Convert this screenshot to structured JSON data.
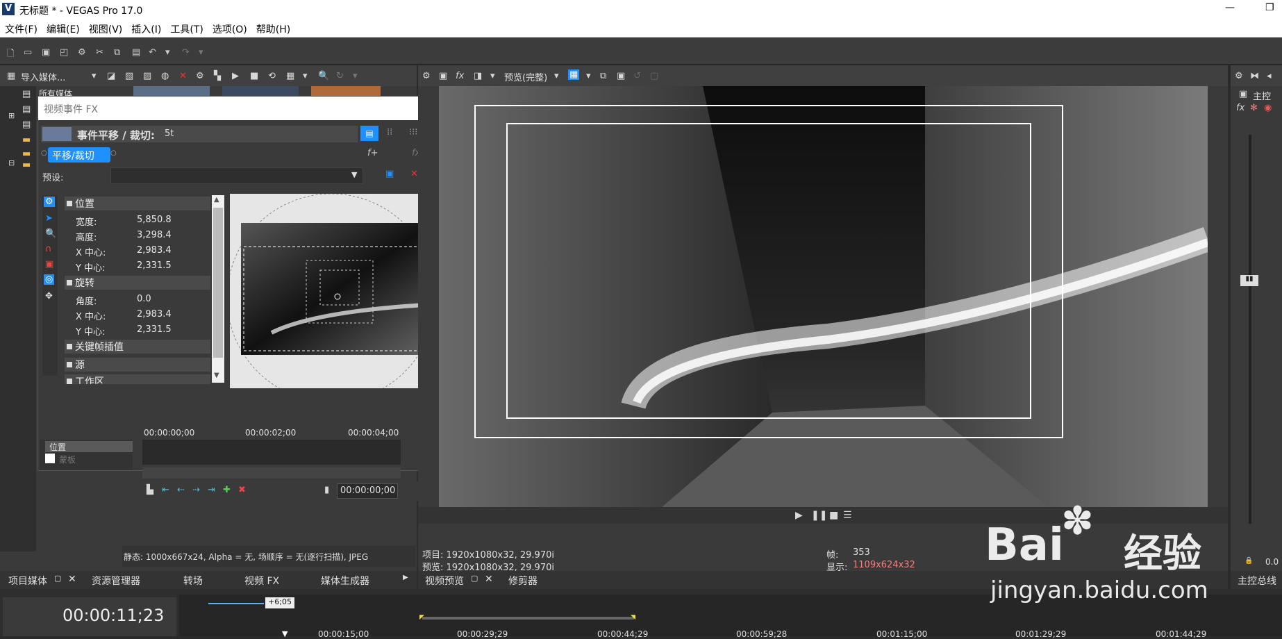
{
  "titlebar": {
    "app_title": "无标题 * - VEGAS Pro 17.0",
    "logo_letter": "V"
  },
  "menu": {
    "items": [
      "文件(F)",
      "编辑(E)",
      "视图(V)",
      "插入(I)",
      "工具(T)",
      "选项(O)",
      "帮助(H)"
    ]
  },
  "media_panel": {
    "import_label": "导入媒体...",
    "tree_root": "所有媒体",
    "status_text": "静态: 1000x667x24, Alpha = 无, 场顺序 = 无(逐行扫描), JPEG"
  },
  "fx_dialog": {
    "title": "视频事件 FX",
    "chain_label": "事件平移 / 裁切:",
    "chain_value": "5t",
    "plugin_chip": "平移/裁切",
    "preset_label": "预设:",
    "preset_value": "",
    "groups": {
      "position": {
        "label": "位置",
        "props": [
          {
            "name": "宽度:",
            "value": "5,850.8"
          },
          {
            "name": "高度:",
            "value": "3,298.4"
          },
          {
            "name": "X 中心:",
            "value": "2,983.4"
          },
          {
            "name": "Y 中心:",
            "value": "2,331.5"
          }
        ]
      },
      "rotation": {
        "label": "旋转",
        "props": [
          {
            "name": "角度:",
            "value": "0.0"
          },
          {
            "name": "X 中心:",
            "value": "2,983.4"
          },
          {
            "name": "Y 中心:",
            "value": "2,331.5"
          }
        ]
      },
      "keyframe_label": "关键帧插值",
      "source_label": "源",
      "workspace_label": "工作区"
    },
    "timeline": {
      "ticks": [
        "00:00:00;00",
        "00:00:02;00",
        "00:00:04;00"
      ],
      "tracks": [
        "位置",
        "蒙板"
      ],
      "timecode": "00:00:00;00"
    }
  },
  "preview": {
    "mode_label": "预览(完整)",
    "project_info": "项目: 1920x1080x32, 29.970i",
    "preview_info": "预览: 1920x1080x32, 29.970i",
    "frame_label": "帧:",
    "frame_value": "353",
    "display_label": "显示:",
    "display_value": "1109x624x32"
  },
  "mixer": {
    "master_label": "主控",
    "value": "0.0"
  },
  "tabs": {
    "left": [
      "项目媒体",
      "资源管理器",
      "转场",
      "视频 FX",
      "媒体生成器"
    ],
    "center": [
      "视频预览",
      "修剪器"
    ],
    "right": [
      "主控总线"
    ]
  },
  "timeline": {
    "current_time": "00:00:11;23",
    "offset_badge": "+6;05",
    "ticks": [
      "00:00:15;00",
      "00:00:29;29",
      "00:00:44;29",
      "00:00:59;28",
      "00:01:15;00",
      "00:01:29;29",
      "00:01:44;29"
    ]
  },
  "watermark": {
    "line1": "Bai",
    "line2": "经验",
    "line3": "jingyan.baidu.com"
  }
}
